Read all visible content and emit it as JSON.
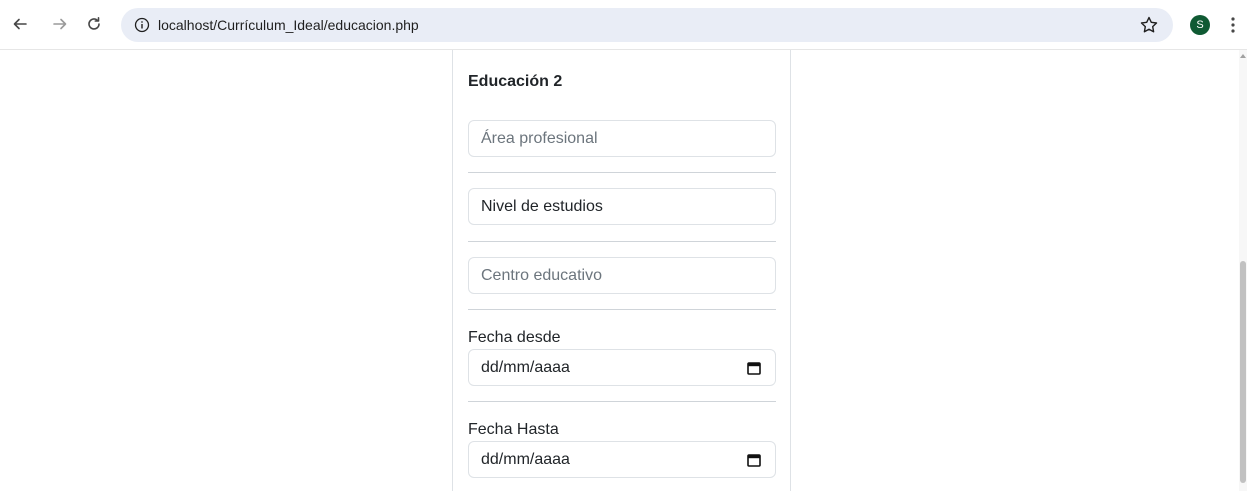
{
  "browser": {
    "url": "localhost/Currículum_Ideal/educacion.php",
    "avatar_letter": "S",
    "icons": {
      "back": "arrow-left-icon",
      "forward": "arrow-right-icon",
      "reload": "reload-icon",
      "info": "info-icon",
      "bookmark": "star-icon",
      "menu": "kebab-menu-icon"
    }
  },
  "form": {
    "section_title": "Educación 2",
    "area_placeholder": "Área profesional",
    "nivel_value": "Nivel de estudios",
    "centro_placeholder": "Centro educativo",
    "fecha_desde_label": "Fecha desde",
    "fecha_desde_value": "dd/mm/aaaa",
    "fecha_hasta_label": "Fecha Hasta",
    "fecha_hasta_value": "dd/mm/aaaa"
  },
  "colors": {
    "avatar_bg": "#0f5a33",
    "omnibox_bg": "#e9edf6",
    "border": "#dee2e6"
  }
}
